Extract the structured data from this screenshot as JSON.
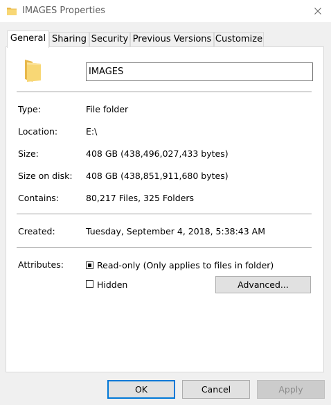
{
  "window": {
    "title": "IMAGES Properties"
  },
  "tabs": [
    {
      "label": "General",
      "active": true
    },
    {
      "label": "Sharing",
      "active": false
    },
    {
      "label": "Security",
      "active": false
    },
    {
      "label": "Previous Versions",
      "active": false
    },
    {
      "label": "Customize",
      "active": false
    }
  ],
  "general": {
    "name": "IMAGES",
    "type_label": "Type:",
    "type_value": "File folder",
    "location_label": "Location:",
    "location_value": "E:\\",
    "size_label": "Size:",
    "size_value": "408 GB (438,496,027,433 bytes)",
    "size_on_disk_label": "Size on disk:",
    "size_on_disk_value": "408 GB (438,851,911,680 bytes)",
    "contains_label": "Contains:",
    "contains_value": "80,217 Files, 325 Folders",
    "created_label": "Created:",
    "created_value": "Tuesday, September 4, 2018, 5:38:43 AM",
    "attributes_label": "Attributes:",
    "readonly_label": "Read-only (Only applies to files in folder)",
    "readonly_state": "indeterminate",
    "hidden_label": "Hidden",
    "hidden_checked": false,
    "advanced_label": "Advanced..."
  },
  "footer": {
    "ok_label": "OK",
    "cancel_label": "Cancel",
    "apply_label": "Apply"
  },
  "colors": {
    "folder_yellow": "#f8d775",
    "folder_dark": "#e8b84a",
    "accent": "#0078d7"
  }
}
